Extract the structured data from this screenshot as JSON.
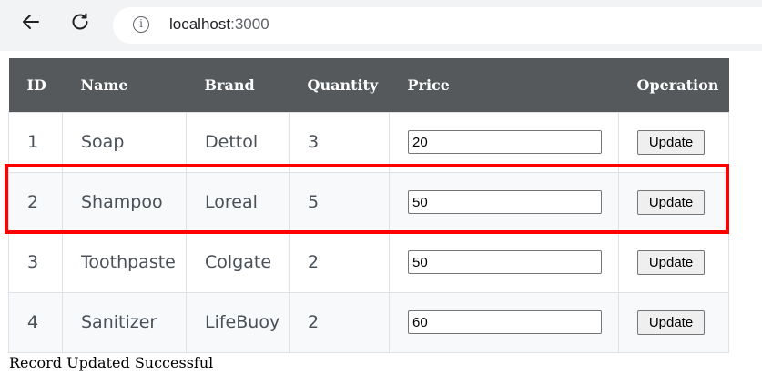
{
  "browser": {
    "url_host": "localhost",
    "url_port": ":3000"
  },
  "table": {
    "headers": [
      "ID",
      "Name",
      "Brand",
      "Quantity",
      "Price",
      "Operation"
    ],
    "rows": [
      {
        "id": "1",
        "name": "Soap",
        "brand": "Dettol",
        "quantity": "3",
        "price": "20",
        "action": "Update"
      },
      {
        "id": "2",
        "name": "Shampoo",
        "brand": "Loreal",
        "quantity": "5",
        "price": "50",
        "action": "Update"
      },
      {
        "id": "3",
        "name": "Toothpaste",
        "brand": "Colgate",
        "quantity": "2",
        "price": "50",
        "action": "Update"
      },
      {
        "id": "4",
        "name": "Sanitizer",
        "brand": "LifeBuoy",
        "quantity": "2",
        "price": "60",
        "action": "Update"
      }
    ]
  },
  "status": {
    "message": "Record Updated Successful"
  },
  "colors": {
    "header_bg": "#55595c",
    "highlight": "#ff0000"
  }
}
